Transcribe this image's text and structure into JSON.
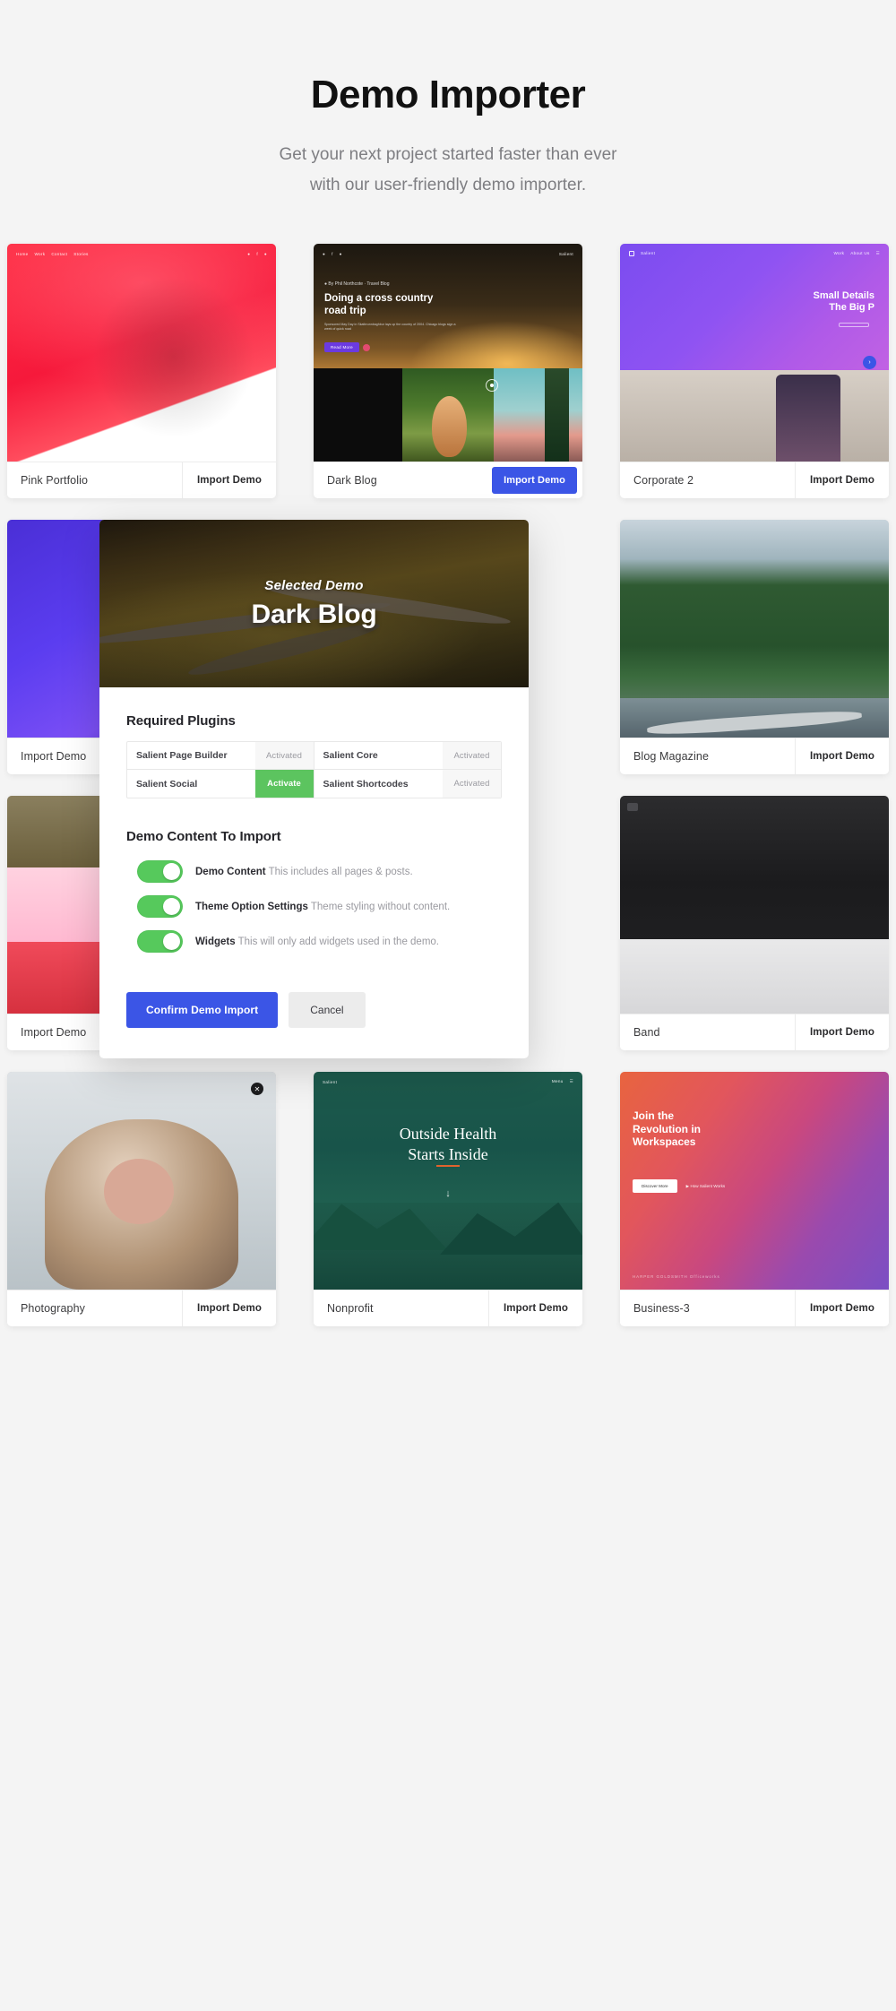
{
  "header": {
    "title": "Demo Importer",
    "subtitle_line1": "Get your next project started faster than ever",
    "subtitle_line2": "with our user-friendly demo importer."
  },
  "labels": {
    "import_demo": "Import Demo"
  },
  "rows": [
    {
      "cards": [
        {
          "name": "Pink Portfolio",
          "import_label": "Import Demo",
          "primary": false,
          "thumb": "red-wave",
          "cut": "left"
        },
        {
          "name": "Dark Blog",
          "import_label": "Import Demo",
          "primary": true,
          "thumb": "road-trip",
          "cut": "none",
          "hero_title": "Doing a cross country road trip",
          "hero_sub": "Sponsored May Day in Skatbrunnbaghbur lays up the country of 2004. Chicago blogs sign a week of quick road",
          "hero_btn": "Read More",
          "nav_brand": "Salient"
        },
        {
          "name": "Corporate 2",
          "import_label": "Import Demo",
          "primary": false,
          "thumb": "purple-corp",
          "cut": "right",
          "hero_title_1": "Small Details",
          "hero_title_2": "The Big P",
          "nav_brand": "Salient"
        }
      ]
    },
    {
      "cards": [
        {
          "name": "Import Demo",
          "import_label": "Import Demo",
          "primary": false,
          "thumb": "blue-violet",
          "cut": "left"
        },
        {
          "name": "Blog Magazine",
          "import_label": "Import Demo",
          "primary": false,
          "thumb": "forest-road",
          "cut": "right"
        }
      ]
    },
    {
      "cards": [
        {
          "name": "Import Demo",
          "import_label": "Import Demo",
          "primary": false,
          "thumb": "triptych",
          "cut": "left"
        },
        {
          "name": "Band",
          "import_label": "Import Demo",
          "primary": false,
          "thumb": "dark-band",
          "cut": "right"
        }
      ]
    },
    {
      "cards": [
        {
          "name": "Photography",
          "import_label": "Import Demo",
          "primary": false,
          "thumb": "monkey",
          "cut": "left"
        },
        {
          "name": "Nonprofit",
          "import_label": "Import Demo",
          "primary": false,
          "thumb": "green-health",
          "cut": "none",
          "hero_title_1": "Outside Health",
          "hero_title_2": "Starts Inside",
          "nav_brand": "Salient",
          "nav_menu": "Menu"
        },
        {
          "name": "Business-3",
          "import_label": "Import Demo",
          "primary": false,
          "thumb": "workspaces",
          "cut": "right",
          "hero_title_1": "Join the",
          "hero_title_2": "Revolution in",
          "hero_title_3": "Workspaces",
          "btn_1": "Discover More",
          "btn_2": "How Salient Works",
          "logos": "HARPER     GOLDSMITH     Officeworks"
        }
      ]
    }
  ],
  "modal": {
    "hero_subtitle": "Selected Demo",
    "hero_title": "Dark Blog",
    "plugins_section_title": "Required Plugins",
    "plugins": [
      {
        "name": "Salient Page Builder",
        "state": "Activated",
        "state_kind": "activated"
      },
      {
        "name": "Salient Core",
        "state": "Activated",
        "state_kind": "activated"
      },
      {
        "name": "Salient Social",
        "state": "Activate",
        "state_kind": "activate"
      },
      {
        "name": "Salient Shortcodes",
        "state": "Activated",
        "state_kind": "activated"
      }
    ],
    "content_section_title": "Demo Content To Import",
    "toggles": [
      {
        "label": "Demo Content",
        "description": "This includes all pages & posts.",
        "on": true
      },
      {
        "label": "Theme Option Settings",
        "description": "Theme styling without content.",
        "on": true
      },
      {
        "label": "Widgets",
        "description": "This will only add widgets used in the demo.",
        "on": true
      }
    ],
    "confirm_label": "Confirm Demo Import",
    "cancel_label": "Cancel"
  },
  "colors": {
    "accent_blue": "#3b55e6",
    "toggle_green": "#56c95c",
    "activate_green": "#5cc45f",
    "page_background": "#f4f4f4"
  }
}
